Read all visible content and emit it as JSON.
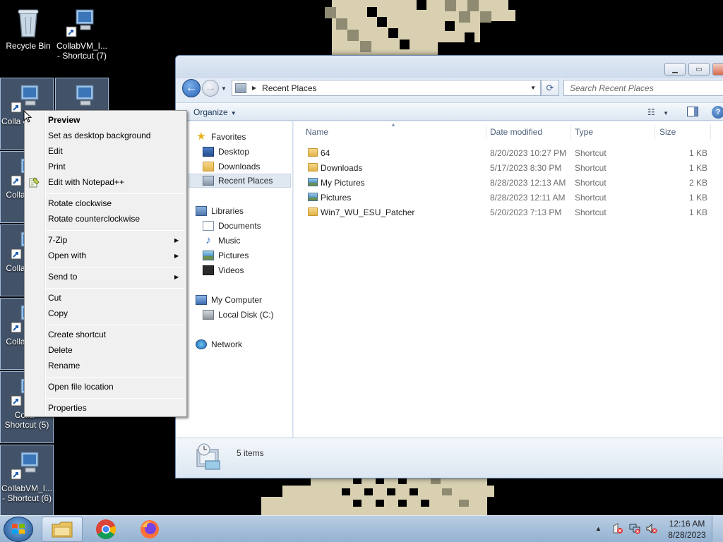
{
  "desktop": {
    "icons": [
      {
        "label": "Recycle Bin"
      },
      {
        "label": "CollabVM_I... - Shortcut (7)"
      },
      {
        "label": "Colla o.p Sho"
      },
      {
        "label": ""
      },
      {
        "label": "Colla - Sho"
      },
      {
        "label": "Colla - Sho"
      },
      {
        "label": "Colla - Sho"
      },
      {
        "label": "Colla - Shortcut (5)"
      },
      {
        "label": "CollabVM_I... - Shortcut (6)"
      }
    ]
  },
  "context_menu": {
    "items": [
      {
        "label": "Preview"
      },
      {
        "label": "Set as desktop background"
      },
      {
        "label": "Edit"
      },
      {
        "label": "Print"
      },
      {
        "label": "Edit with Notepad++"
      },
      {
        "label": "Rotate clockwise"
      },
      {
        "label": "Rotate counterclockwise"
      },
      {
        "label": "7-Zip"
      },
      {
        "label": "Open with"
      },
      {
        "label": "Send to"
      },
      {
        "label": "Cut"
      },
      {
        "label": "Copy"
      },
      {
        "label": "Create shortcut"
      },
      {
        "label": "Delete"
      },
      {
        "label": "Rename"
      },
      {
        "label": "Open file location"
      },
      {
        "label": "Properties"
      }
    ]
  },
  "explorer": {
    "address": "Recent Places",
    "search_placeholder": "Search Recent Places",
    "organize_label": "Organize",
    "nav": {
      "favorites_label": "Favorites",
      "favorites": [
        "Desktop",
        "Downloads",
        "Recent Places"
      ],
      "libraries_label": "Libraries",
      "libraries": [
        "Documents",
        "Music",
        "Pictures",
        "Videos"
      ],
      "computer_label": "My Computer",
      "drives": [
        "Local Disk (C:)"
      ],
      "network_label": "Network"
    },
    "columns": {
      "name": "Name",
      "date": "Date modified",
      "type": "Type",
      "size": "Size"
    },
    "files": [
      {
        "name": "64",
        "date": "8/20/2023 10:27 PM",
        "type": "Shortcut",
        "size": "1 KB",
        "icon": "folder-icon"
      },
      {
        "name": "Downloads",
        "date": "5/17/2023 8:30 PM",
        "type": "Shortcut",
        "size": "1 KB",
        "icon": "folder-icon"
      },
      {
        "name": "My Pictures",
        "date": "8/28/2023 12:13 AM",
        "type": "Shortcut",
        "size": "2 KB",
        "icon": "pictures-library-icon"
      },
      {
        "name": "Pictures",
        "date": "8/28/2023 12:11 AM",
        "type": "Shortcut",
        "size": "1 KB",
        "icon": "pictures-library-icon"
      },
      {
        "name": "Win7_WU_ESU_Patcher",
        "date": "5/20/2023 7:13 PM",
        "type": "Shortcut",
        "size": "1 KB",
        "icon": "folder-icon"
      }
    ],
    "status_text": "5 items"
  },
  "taskbar": {
    "time": "12:16 AM",
    "date": "8/28/2023"
  }
}
